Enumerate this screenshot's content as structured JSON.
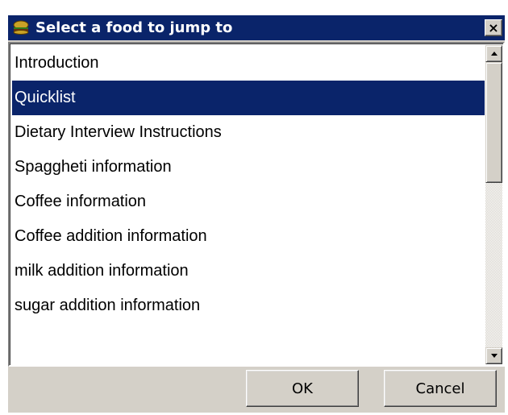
{
  "window": {
    "title": "Select a food to jump to",
    "title_icon": "burger-icon",
    "close_label": "×"
  },
  "list": {
    "selected_index": 1,
    "items": [
      "Introduction",
      "Quicklist",
      "Dietary Interview Instructions",
      "Spaggheti information",
      "Coffee information",
      "Coffee addition information",
      "milk addition information",
      "sugar addition information"
    ]
  },
  "buttons": {
    "ok_label": "OK",
    "cancel_label": "Cancel"
  },
  "colors": {
    "titlebar": "#0a246a",
    "selection": "#0a246a",
    "face": "#d4d0c8"
  }
}
